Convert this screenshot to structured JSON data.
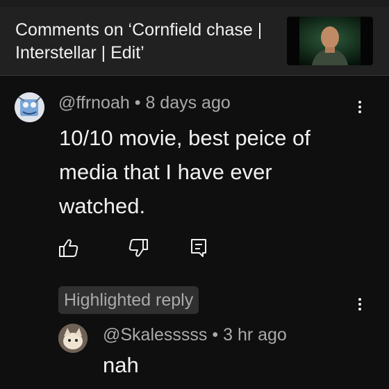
{
  "header": {
    "title": "Comments on ‘Cornfield chase | Interstellar | Edit’"
  },
  "comment": {
    "author": "@ffrnoah",
    "separator": "•",
    "age": "8 days ago",
    "text": "10/10 movie, best peice of media that I have ever watched."
  },
  "reply": {
    "badge": "Highlighted reply",
    "author": "@Skalesssss",
    "separator": "•",
    "age": "3 hr ago",
    "text": "nah"
  },
  "icons": {
    "like": "thumbs-up-icon",
    "dislike": "thumbs-down-icon",
    "reply": "reply-icon",
    "menu": "more-vert-icon"
  },
  "colors": {
    "background": "#0f0f0f",
    "header_bg": "#212121",
    "primary_text": "#f1f1f1",
    "secondary_text": "#aaaaaa",
    "badge_bg": "#303030"
  }
}
